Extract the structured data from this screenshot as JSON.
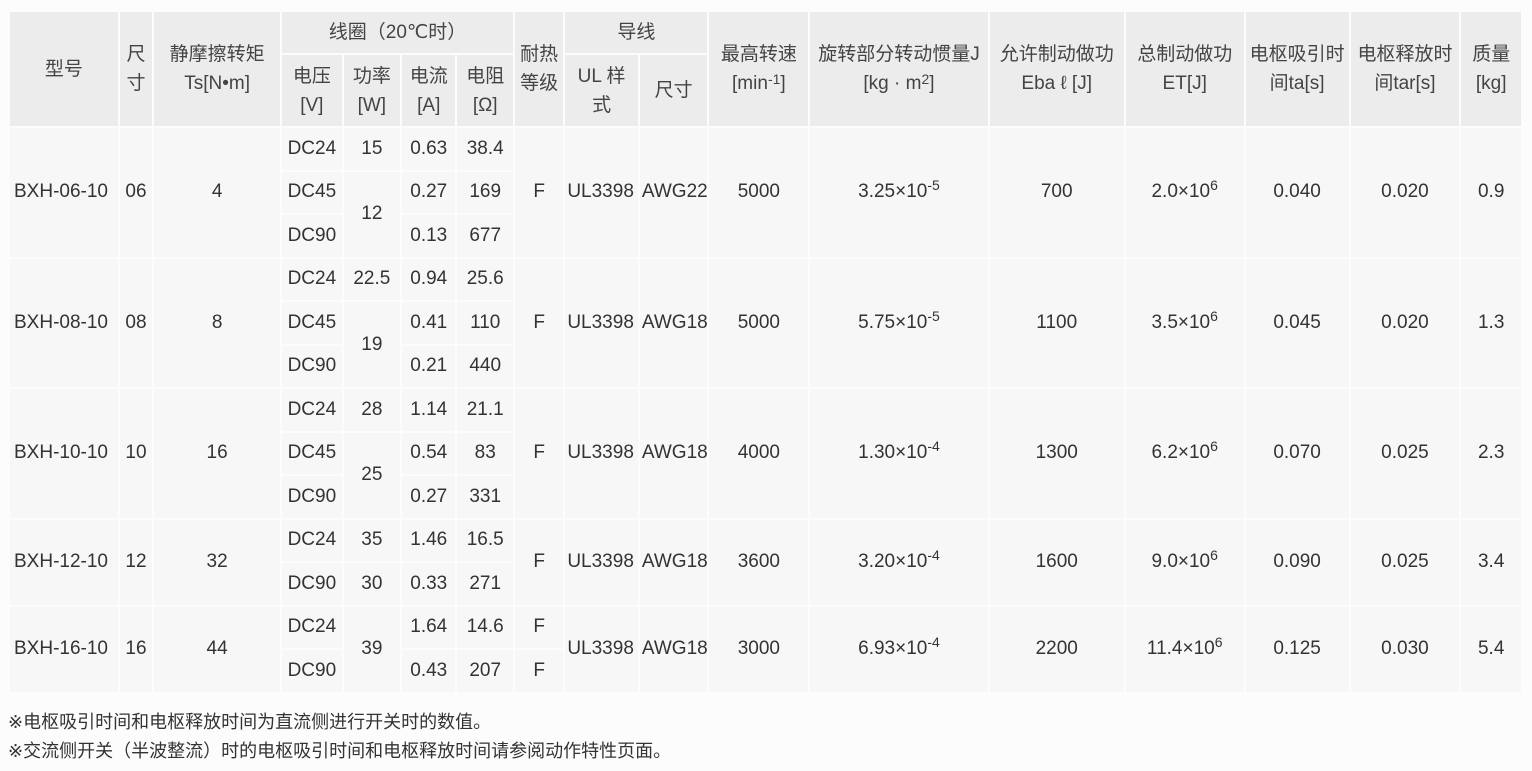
{
  "headers": {
    "model": "型号",
    "size": "尺寸",
    "static_torque": "静摩擦转矩",
    "static_torque_unit": "Ts[N•m]",
    "coil": "线圈（20℃时）",
    "voltage": "电压",
    "voltage_unit": "[V]",
    "power": "功率",
    "power_unit": "[W]",
    "current": "电流",
    "current_unit": "[A]",
    "resistance": "电阻",
    "resistance_unit": "[Ω]",
    "heat_class_1": "耐热",
    "heat_class_2": "等级",
    "lead": "导线",
    "ul_style_1": "UL 样",
    "ul_style_2": "式",
    "lead_size": "尺寸",
    "max_speed": "最高转速",
    "max_speed_unit_pre": "[min",
    "max_speed_unit_sup": "-1",
    "max_speed_unit_post": "]",
    "inertia": "旋转部分转动惯量J",
    "inertia_unit_pre": "[kg · m",
    "inertia_unit_sup": "2",
    "inertia_unit_post": "]",
    "allow_work": "允许制动做功",
    "allow_work_unit": "Eba ℓ [J]",
    "total_work": "总制动做功",
    "total_work_unit": "ET[J]",
    "attract_time_1": "电枢吸引时",
    "attract_time_2": "间ta[s]",
    "release_time_1": "电枢释放时",
    "release_time_2": "间tar[s]",
    "mass": "质量",
    "mass_unit": "[kg]"
  },
  "rows": [
    {
      "model": "BXH-06-10",
      "size": "06",
      "torque": "4",
      "coil": [
        {
          "v": "DC24",
          "p": "15",
          "a": "0.63",
          "r": "38.4"
        },
        {
          "v": "DC45",
          "p": "12",
          "a": "0.27",
          "r": "169"
        },
        {
          "v": "DC90",
          "a": "0.13",
          "r": "677"
        }
      ],
      "heat": "F",
      "ul": "UL3398",
      "awg": "AWG22",
      "speed": "5000",
      "inertia_base": "3.25×10",
      "inertia_exp": "-5",
      "allow": "700",
      "total_base": "2.0×10",
      "total_exp": "6",
      "ta": "0.040",
      "tar": "0.020",
      "mass": "0.9"
    },
    {
      "model": "BXH-08-10",
      "size": "08",
      "torque": "8",
      "coil": [
        {
          "v": "DC24",
          "p": "22.5",
          "a": "0.94",
          "r": "25.6"
        },
        {
          "v": "DC45",
          "p": "19",
          "a": "0.41",
          "r": "110"
        },
        {
          "v": "DC90",
          "a": "0.21",
          "r": "440"
        }
      ],
      "heat": "F",
      "ul": "UL3398",
      "awg": "AWG18",
      "speed": "5000",
      "inertia_base": "5.75×10",
      "inertia_exp": "-5",
      "allow": "1100",
      "total_base": "3.5×10",
      "total_exp": "6",
      "ta": "0.045",
      "tar": "0.020",
      "mass": "1.3"
    },
    {
      "model": "BXH-10-10",
      "size": "10",
      "torque": "16",
      "coil": [
        {
          "v": "DC24",
          "p": "28",
          "a": "1.14",
          "r": "21.1"
        },
        {
          "v": "DC45",
          "p": "25",
          "a": "0.54",
          "r": "83"
        },
        {
          "v": "DC90",
          "a": "0.27",
          "r": "331"
        }
      ],
      "heat": "F",
      "ul": "UL3398",
      "awg": "AWG18",
      "speed": "4000",
      "inertia_base": "1.30×10",
      "inertia_exp": "-4",
      "allow": "1300",
      "total_base": "6.2×10",
      "total_exp": "6",
      "ta": "0.070",
      "tar": "0.025",
      "mass": "2.3"
    },
    {
      "model": "BXH-12-10",
      "size": "12",
      "torque": "32",
      "coil": [
        {
          "v": "DC24",
          "p": "35",
          "a": "1.46",
          "r": "16.5"
        },
        {
          "v": "DC90",
          "p": "30",
          "a": "0.33",
          "r": "271"
        }
      ],
      "heat": "F",
      "ul": "UL3398",
      "awg": "AWG18",
      "speed": "3600",
      "inertia_base": "3.20×10",
      "inertia_exp": "-4",
      "allow": "1600",
      "total_base": "9.0×10",
      "total_exp": "6",
      "ta": "0.090",
      "tar": "0.025",
      "mass": "3.4"
    },
    {
      "model": "BXH-16-10",
      "size": "16",
      "torque": "44",
      "coil": [
        {
          "v": "DC24",
          "p": "39",
          "a": "1.64",
          "r": "14.6",
          "heat": "F"
        },
        {
          "v": "DC90",
          "a": "0.43",
          "r": "207",
          "heat": "F"
        }
      ],
      "ul": "UL3398",
      "awg": "AWG18",
      "speed": "3000",
      "inertia_base": "6.93×10",
      "inertia_exp": "-4",
      "allow": "2200",
      "total_base": "11.4×10",
      "total_exp": "6",
      "ta": "0.125",
      "tar": "0.030",
      "mass": "5.4"
    }
  ],
  "notes": [
    "※电枢吸引时间和电枢释放时间为直流侧进行开关时的数值。",
    "※交流侧开关（半波整流）时的电枢吸引时间和电枢释放时间请参阅动作特性页面。"
  ]
}
